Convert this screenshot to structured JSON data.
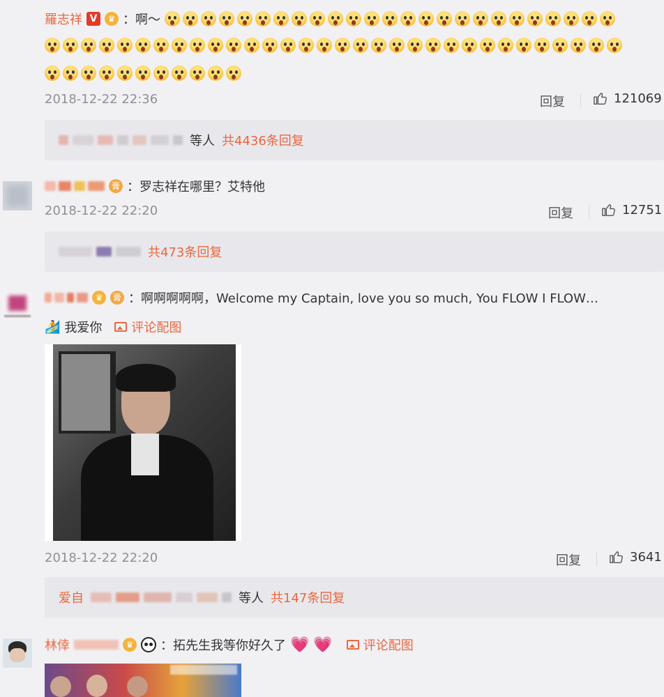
{
  "comments": [
    {
      "name": "羅志祥",
      "verified": "V",
      "text": "：啊～",
      "date": "2018-12-22 22:36",
      "reply_label": "回复",
      "likes": "121069",
      "summary_suffix": "等人",
      "summary_count": "共4436条回复"
    },
    {
      "text": "：罗志祥在哪里？艾特他",
      "date": "2018-12-22 22:20",
      "reply_label": "回复",
      "likes": "12751",
      "summary_count": "共473条回复"
    },
    {
      "text": "：啊啊啊啊啊，Welcome my Captain, love you so much, You FLOW I FLOW…",
      "topic": "我爱你",
      "image_link": "评论配图",
      "date": "2018-12-22 22:20",
      "reply_label": "回复",
      "likes": "3641",
      "summary_prefix": "爱自",
      "summary_suffix": "等人",
      "summary_count": "共147条回复"
    },
    {
      "name": "林倖",
      "text": "：拓先生我等你好久了",
      "image_link": "评论配图"
    }
  ],
  "colors": {
    "accent": "#e8673f",
    "background": "#f1f1f4",
    "summary_bg": "#e8e8ec"
  }
}
